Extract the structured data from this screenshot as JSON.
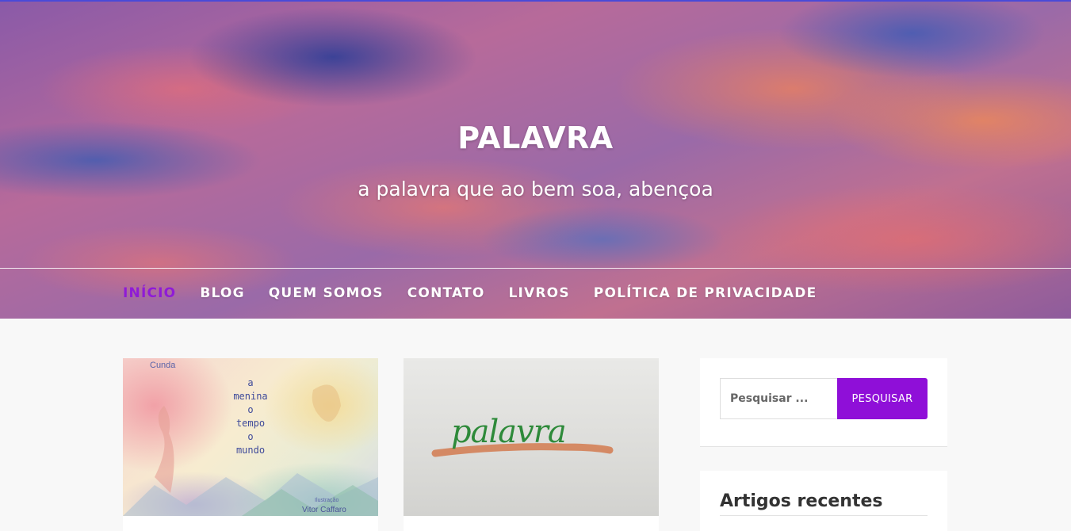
{
  "site": {
    "title": "PALAVRA",
    "tagline": "a palavra que ao bem soa, abençoa"
  },
  "nav": {
    "items": [
      {
        "label": "INÍCIO",
        "active": true
      },
      {
        "label": "BLOG",
        "active": false
      },
      {
        "label": "QUEM SOMOS",
        "active": false
      },
      {
        "label": "CONTATO",
        "active": false
      },
      {
        "label": "LIVROS",
        "active": false
      },
      {
        "label": "POLÍTICA DE PRIVACIDADE",
        "active": false
      }
    ]
  },
  "posts": [
    {
      "cover_author": "Cunda",
      "cover_lines": [
        "a",
        "menina",
        "o",
        "tempo",
        "o",
        "mundo"
      ],
      "cover_illustration_label": "Ilustração",
      "cover_illustrator": "Vitor Caffaro"
    },
    {
      "cover_word": "palavra"
    }
  ],
  "sidebar": {
    "search": {
      "placeholder": "Pesquisar ...",
      "button_label": "PESQUISAR"
    },
    "recent": {
      "title": "Artigos recentes"
    }
  },
  "colors": {
    "accent": "#8f0fd8",
    "nav_active": "#8f1bd6",
    "page_background": "#f8f8f8"
  }
}
